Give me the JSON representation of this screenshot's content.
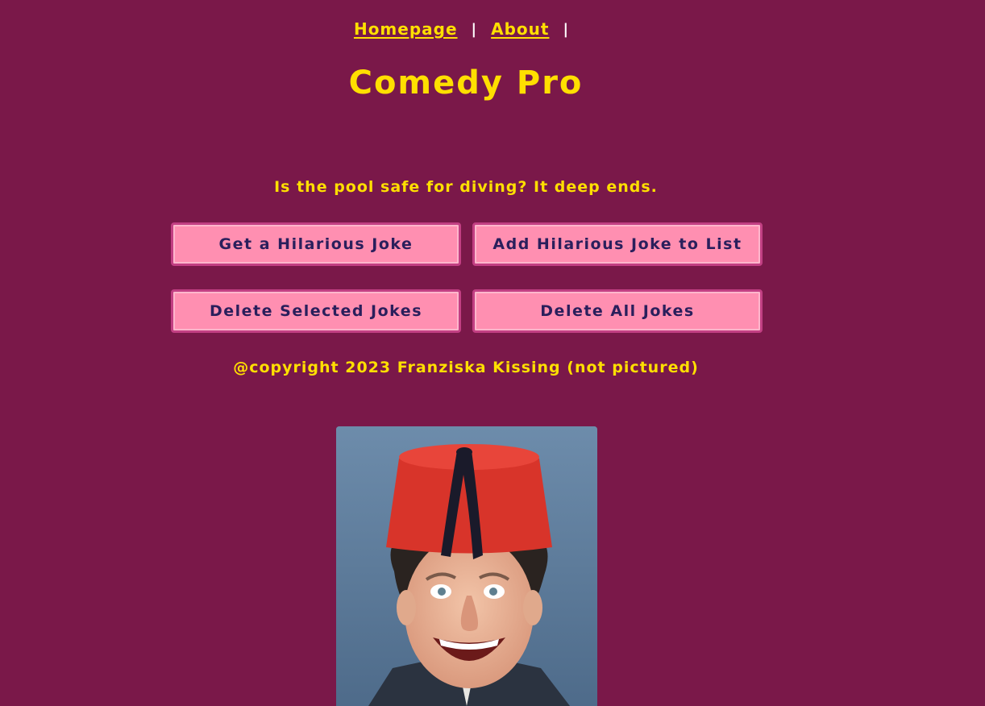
{
  "nav": {
    "homepage_label": "Homepage",
    "separator1": "|",
    "about_label": "About",
    "separator2": "|"
  },
  "header": {
    "title": "Comedy Pro"
  },
  "main": {
    "joke_text": "Is the pool safe for diving? It deep ends.",
    "buttons": {
      "get_joke": "Get a Hilarious Joke",
      "add_joke": "Add Hilarious Joke to List",
      "delete_selected": "Delete Selected Jokes",
      "delete_all": "Delete All Jokes"
    },
    "copyright": "@copyright 2023 Franziska Kissing (not pictured)"
  },
  "image": {
    "alt": "comedian in red fez"
  },
  "colors": {
    "background": "#7a1849",
    "accent_text": "#ffdf00",
    "button_bg": "#ff8fb1",
    "button_border": "#c23f83",
    "button_text": "#2a1f5c"
  }
}
